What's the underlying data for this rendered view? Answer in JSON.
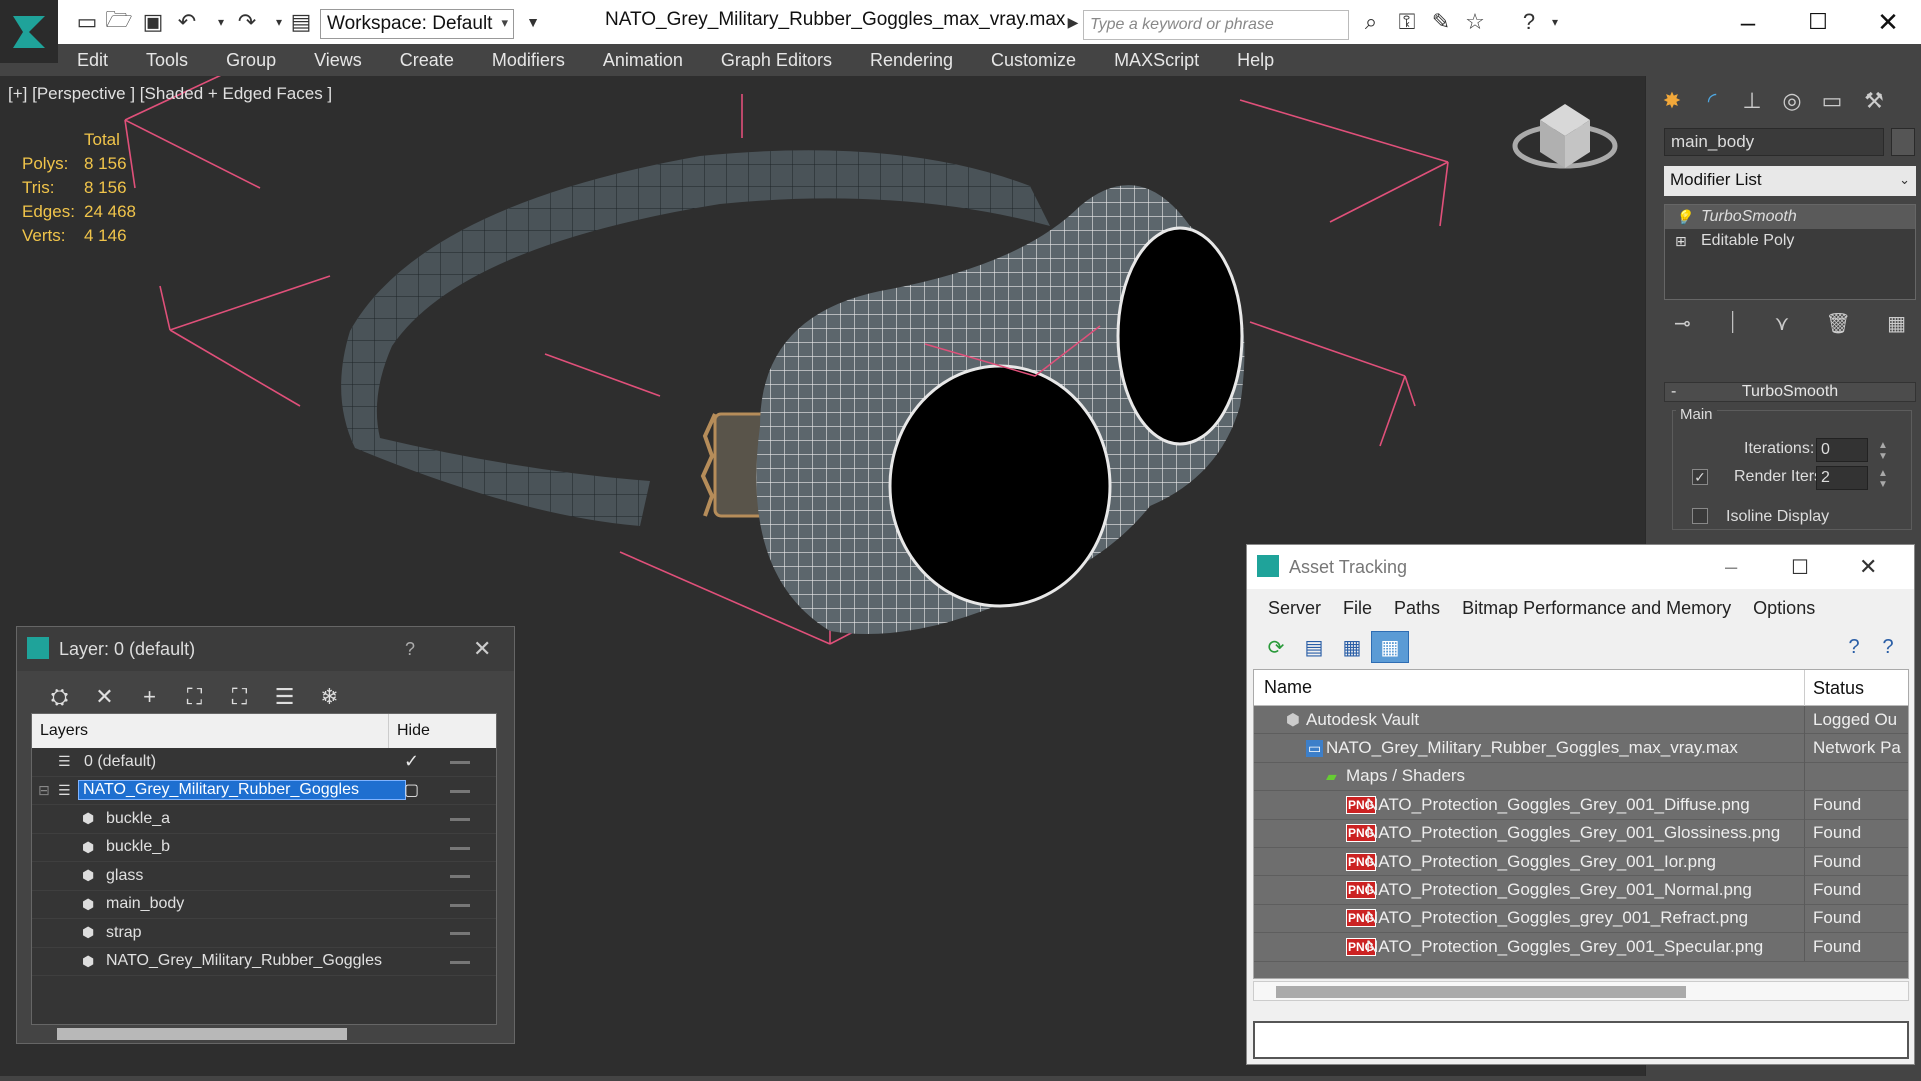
{
  "app": {
    "workspace_label": "Workspace: Default",
    "doc_title": "NATO_Grey_Military_Rubber_Goggles_max_vray.max",
    "search_placeholder": "Type a keyword or phrase"
  },
  "menu": [
    "Edit",
    "Tools",
    "Group",
    "Views",
    "Create",
    "Modifiers",
    "Animation",
    "Graph Editors",
    "Rendering",
    "Customize",
    "MAXScript",
    "Help"
  ],
  "viewport": {
    "label": "[+] [Perspective ] [Shaded + Edged Faces ]",
    "stats_header": "Total",
    "stats": [
      {
        "k": "Polys:",
        "v": "8 156"
      },
      {
        "k": "Tris:",
        "v": "8 156"
      },
      {
        "k": "Edges:",
        "v": "24 468"
      },
      {
        "k": "Verts:",
        "v": "4 146"
      }
    ]
  },
  "command_panel": {
    "object_name": "main_body",
    "modifier_list": "Modifier List",
    "stack": [
      "TurboSmooth",
      "Editable Poly"
    ],
    "rollout_title": "TurboSmooth",
    "group_title": "Main",
    "iterations_label": "Iterations:",
    "iterations_value": "0",
    "render_iters_label": "Render Iters:",
    "render_iters_value": "2",
    "isoline_label": "Isoline Display"
  },
  "layer_dialog": {
    "title": "Layer: 0 (default)",
    "help": "?",
    "col_layers": "Layers",
    "col_hide": "Hide",
    "rows": [
      {
        "name": "0 (default)",
        "level": 0,
        "current": true,
        "selected": false
      },
      {
        "name": "NATO_Grey_Military_Rubber_Goggles",
        "level": 0,
        "current": false,
        "selected": true
      },
      {
        "name": "buckle_a",
        "level": 1,
        "current": false,
        "selected": false
      },
      {
        "name": "buckle_b",
        "level": 1,
        "current": false,
        "selected": false
      },
      {
        "name": "glass",
        "level": 1,
        "current": false,
        "selected": false
      },
      {
        "name": "main_body",
        "level": 1,
        "current": false,
        "selected": false
      },
      {
        "name": "strap",
        "level": 1,
        "current": false,
        "selected": false
      },
      {
        "name": "NATO_Grey_Military_Rubber_Goggles",
        "level": 1,
        "current": false,
        "selected": false
      }
    ]
  },
  "asset_dialog": {
    "title": "Asset Tracking",
    "menu": [
      "Server",
      "File",
      "Paths",
      "Bitmap Performance and Memory",
      "Options"
    ],
    "col_name": "Name",
    "col_status": "Status",
    "rows": [
      {
        "name": "Autodesk Vault",
        "status": "Logged Ou",
        "level": 0,
        "icon": "vault"
      },
      {
        "name": "NATO_Grey_Military_Rubber_Goggles_max_vray.max",
        "status": "Network Pa",
        "level": 1,
        "icon": "max"
      },
      {
        "name": "Maps / Shaders",
        "status": "",
        "level": 2,
        "icon": "maps"
      },
      {
        "name": "NATO_Protection_Goggles_Grey_001_Diffuse.png",
        "status": "Found",
        "level": 3,
        "icon": "png"
      },
      {
        "name": "NATO_Protection_Goggles_Grey_001_Glossiness.png",
        "status": "Found",
        "level": 3,
        "icon": "png"
      },
      {
        "name": "NATO_Protection_Goggles_Grey_001_Ior.png",
        "status": "Found",
        "level": 3,
        "icon": "png"
      },
      {
        "name": "NATO_Protection_Goggles_Grey_001_Normal.png",
        "status": "Found",
        "level": 3,
        "icon": "png"
      },
      {
        "name": "NATO_Protection_Goggles_grey_001_Refract.png",
        "status": "Found",
        "level": 3,
        "icon": "png"
      },
      {
        "name": "NATO_Protection_Goggles_Grey_001_Specular.png",
        "status": "Found",
        "level": 3,
        "icon": "png"
      }
    ]
  },
  "colors": {
    "accent": "#1e6fd0",
    "stats": "#f0c44a",
    "gizmo": "#e0507a"
  }
}
